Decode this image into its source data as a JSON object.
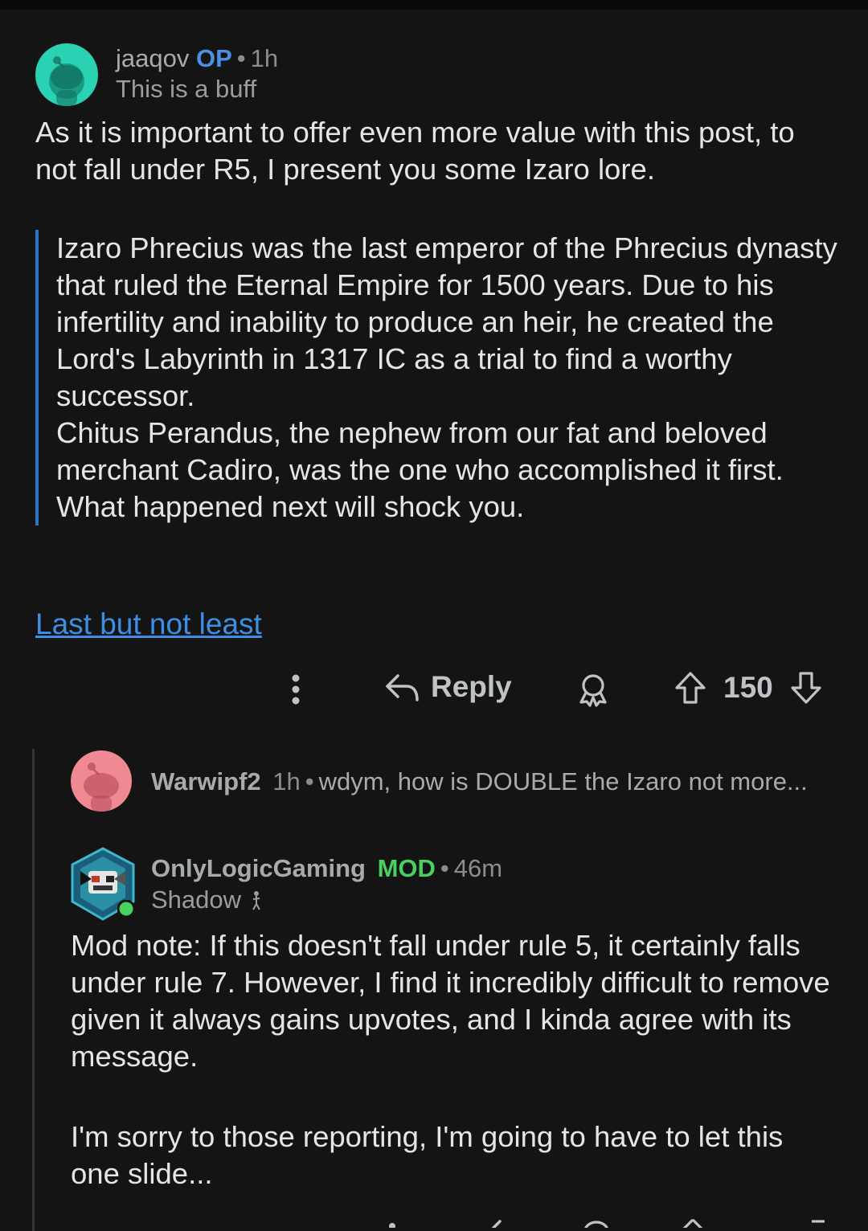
{
  "comment1": {
    "username": "jaaqov",
    "tag": "OP",
    "separator": "•",
    "time": "1h",
    "flair": "This is a buff",
    "intro": "As it is important to offer even more value with this post, to not fall under R5, I present you some Izaro lore.",
    "quote": [
      "Izaro Phrecius was the last emperor of the Phrecius dynasty that ruled the Eternal Empire for 1500 years. Due to his infertility and inability to produce an heir, he created the Lord's Labyrinth in 1317 IC as a trial to find a worthy successor.",
      "Chitus Perandus, the nephew from our fat and beloved merchant Cadiro, was the one who accomplished it first.",
      "What happened next will shock you."
    ],
    "link_text": "Last but not least",
    "actions": {
      "reply_label": "Reply",
      "vote_count": "150"
    }
  },
  "comment2": {
    "username": "Warwipf2",
    "time": "1h",
    "separator": "•",
    "preview": "wdym, how is DOUBLE the Izaro not more..."
  },
  "comment3": {
    "username": "OnlyLogicGaming",
    "tag": "MOD",
    "separator": "•",
    "time": "46m",
    "flair": "Shadow",
    "paragraph1": "Mod note: If this doesn't fall under rule 5, it certainly falls under rule 7. However, I find it incredibly difficult to remove given it always gains upvotes, and I kinda agree with its message.",
    "paragraph2": "I'm sorry to those reporting, I'm going to have to let this one slide..."
  },
  "colors": {
    "background": "#141414",
    "op_tag": "#4a90e2",
    "mod_tag": "#46d160",
    "link": "#3d8fe6",
    "quote_bar": "#2f73c9",
    "avatar1": "#2ad1b3",
    "avatar2": "#f08a92"
  },
  "icons": [
    "more-vertical-icon",
    "reply-arrow-icon",
    "award-icon",
    "upvote-arrow-icon",
    "downvote-arrow-icon",
    "snoo-avatar-icon",
    "online-status-icon",
    "shadow-flair-icon"
  ]
}
